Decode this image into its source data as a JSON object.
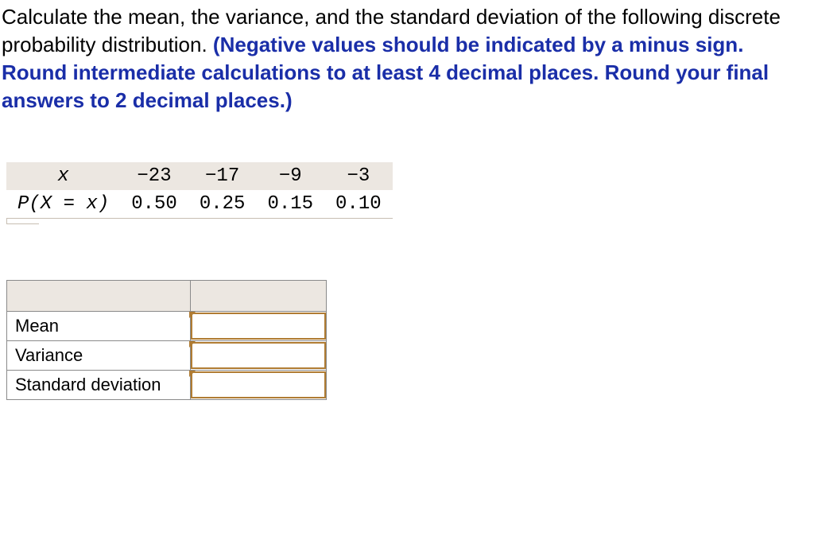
{
  "question": {
    "intro": "Calculate the mean, the variance, and the standard deviation of the following discrete probability distribution. ",
    "bold": "(Negative values should be indicated by a minus sign. Round intermediate calculations to at least 4 decimal places. Round your final answers to 2 decimal places.)"
  },
  "distribution": {
    "row_label_x": "x",
    "row_label_p": "P(X = x)",
    "x": [
      "−23",
      "−17",
      "−9",
      "−3"
    ],
    "p": [
      "0.50",
      "0.25",
      "0.15",
      "0.10"
    ]
  },
  "answers": {
    "rows": [
      {
        "label": "Mean",
        "value": ""
      },
      {
        "label": "Variance",
        "value": ""
      },
      {
        "label": "Standard deviation",
        "value": ""
      }
    ]
  }
}
